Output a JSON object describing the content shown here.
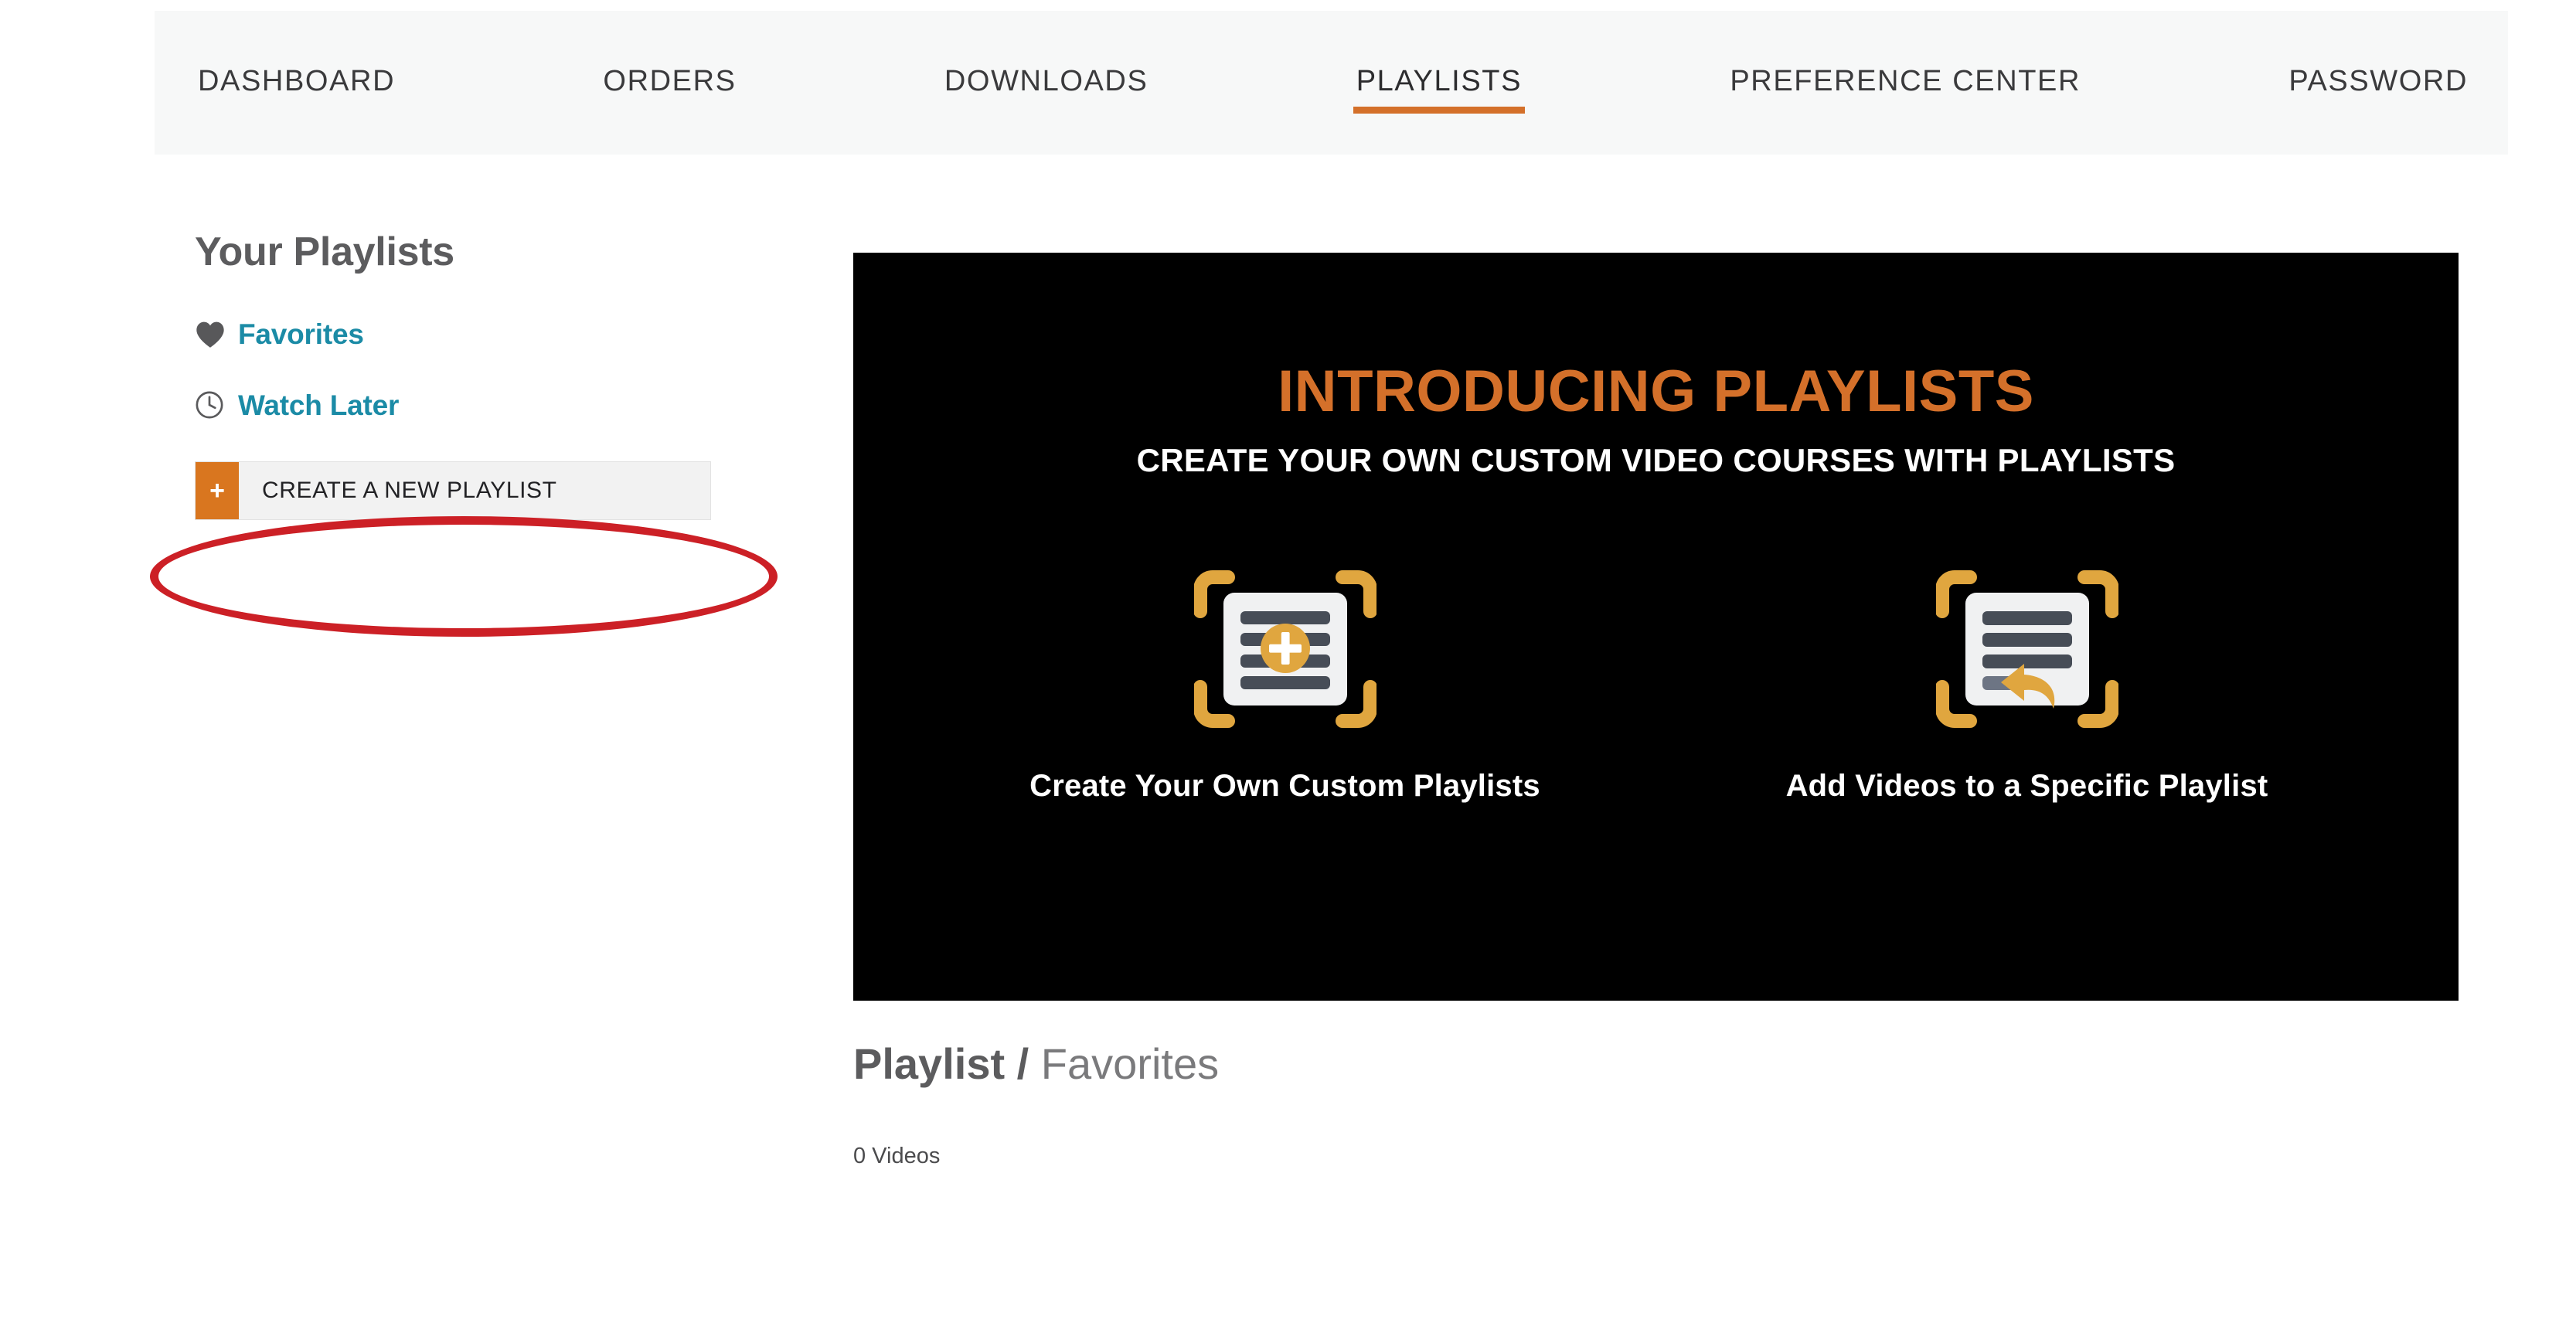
{
  "nav": {
    "tabs": [
      {
        "label": "DASHBOARD",
        "active": false
      },
      {
        "label": "ORDERS",
        "active": false
      },
      {
        "label": "DOWNLOADS",
        "active": false
      },
      {
        "label": "PLAYLISTS",
        "active": true
      },
      {
        "label": "PREFERENCE CENTER",
        "active": false
      },
      {
        "label": "PASSWORD",
        "active": false
      }
    ],
    "active_tab": "PLAYLISTS",
    "accent_color": "#d4702a",
    "background_color": "#f7f8f8",
    "text_color": "#3a3a3c"
  },
  "sidebar": {
    "title": "Your Playlists",
    "items": [
      {
        "label": "Favorites",
        "icon": "heart-icon"
      },
      {
        "label": "Watch Later",
        "icon": "clock-icon"
      }
    ],
    "link_color": "#1b8ba6",
    "create_button": {
      "label": "CREATE A NEW PLAYLIST",
      "plus_glyph": "+",
      "plus_color": "#d9761f",
      "background_color": "#f2f2f2"
    }
  },
  "annotation": {
    "shape": "ellipse",
    "color": "#cc2026",
    "target": "create-a-new-playlist-button"
  },
  "banner": {
    "title": "INTRODUCING PLAYLISTS",
    "subtitle": "CREATE YOUR OWN CUSTOM VIDEO COURSES WITH PLAYLISTS",
    "background_color": "#000000",
    "title_color": "#d4702a",
    "cards": [
      {
        "caption": "Create Your Own Custom Playlists",
        "icon": "playlist-add-icon"
      },
      {
        "caption": "Add Videos to a Specific Playlist",
        "icon": "playlist-arrow-icon"
      }
    ]
  },
  "playlist_section": {
    "heading_prefix": "Playlist /",
    "heading_name": "Favorites",
    "video_count": "0 Videos"
  }
}
